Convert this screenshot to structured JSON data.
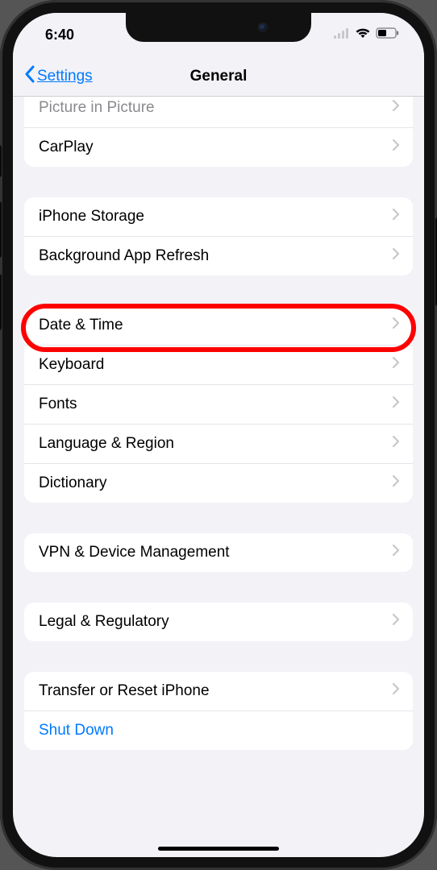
{
  "status": {
    "time": "6:40"
  },
  "nav": {
    "back_label": "Settings",
    "title": "General"
  },
  "groups": [
    {
      "rows": [
        {
          "key": "picture-in-picture",
          "label": "Picture in Picture",
          "cut": true
        },
        {
          "key": "carplay",
          "label": "CarPlay"
        }
      ]
    },
    {
      "rows": [
        {
          "key": "iphone-storage",
          "label": "iPhone Storage",
          "highlighted": true
        },
        {
          "key": "background-app-refresh",
          "label": "Background App Refresh"
        }
      ]
    },
    {
      "rows": [
        {
          "key": "date-time",
          "label": "Date & Time"
        },
        {
          "key": "keyboard",
          "label": "Keyboard"
        },
        {
          "key": "fonts",
          "label": "Fonts"
        },
        {
          "key": "language-region",
          "label": "Language & Region"
        },
        {
          "key": "dictionary",
          "label": "Dictionary"
        }
      ]
    },
    {
      "rows": [
        {
          "key": "vpn-device-management",
          "label": "VPN & Device Management"
        }
      ]
    },
    {
      "rows": [
        {
          "key": "legal-regulatory",
          "label": "Legal & Regulatory"
        }
      ]
    },
    {
      "rows": [
        {
          "key": "transfer-reset",
          "label": "Transfer or Reset iPhone"
        },
        {
          "key": "shut-down",
          "label": "Shut Down",
          "style": "link",
          "no_chevron": true
        }
      ]
    }
  ]
}
